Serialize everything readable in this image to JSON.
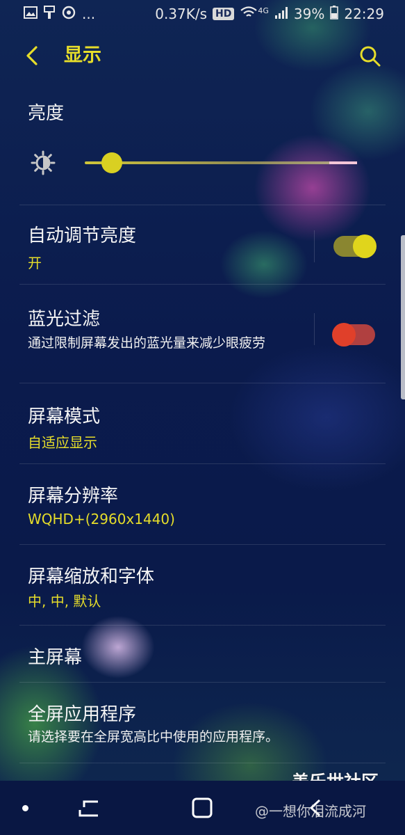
{
  "status_bar": {
    "left_icons": [
      "image-icon",
      "brush-icon",
      "sync-icon"
    ],
    "ellipsis": "...",
    "net_speed": "0.37K/s",
    "hd_badge": "HD",
    "network_type": "4G",
    "battery": "39%",
    "time": "22:29"
  },
  "header": {
    "back_icon": "chevron-left-icon",
    "title": "显示",
    "search_icon": "search-icon"
  },
  "brightness": {
    "title": "亮度",
    "level": 0.07
  },
  "settings": [
    {
      "title": "自动调节亮度",
      "subtitle": "开",
      "toggle": true
    },
    {
      "title": "蓝光过滤",
      "subtitle": "通过限制屏幕发出的蓝光量来减少眼疲劳",
      "toggle": false
    },
    {
      "title": "屏幕模式",
      "subtitle": "自适应显示"
    },
    {
      "title": "屏幕分辨率",
      "subtitle": "WQHD+(2960x1440)"
    },
    {
      "title": "屏幕缩放和字体",
      "subtitle": "中, 中, 默认"
    },
    {
      "title": "主屏幕"
    },
    {
      "title": "全屏应用程序",
      "subtitle": "请选择要在全屏宽高比中使用的应用程序。"
    }
  ],
  "watermark": {
    "brand": "盖乐世社区",
    "user": "@一想你泪流成河"
  },
  "colors": {
    "accent": "#e6dd2a",
    "toggle_off": "#e0402a",
    "background": "#0d1a4a"
  }
}
